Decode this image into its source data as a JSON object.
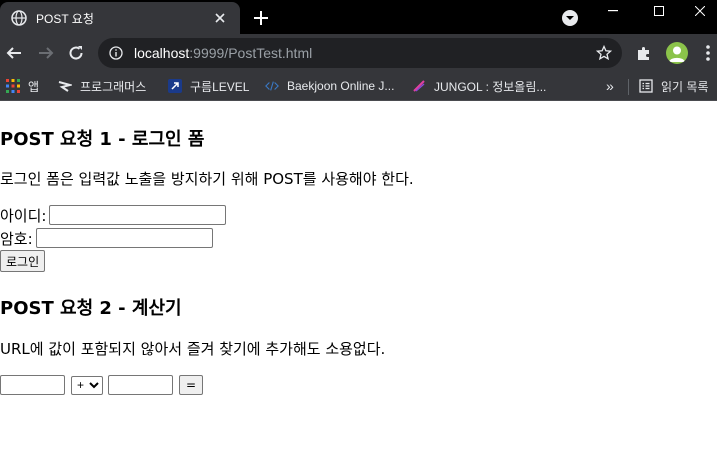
{
  "browser": {
    "tab_title": "POST 요청",
    "url_host": "localhost",
    "url_path": ":9999/PostTest.html",
    "bookmarks": [
      {
        "label": "앱",
        "icon": "apps-grid-icon"
      },
      {
        "label": "프로그래머스",
        "icon": "programmers-icon"
      },
      {
        "label": "구름LEVEL",
        "icon": "goorm-icon"
      },
      {
        "label": "Baekjoon Online J...",
        "icon": "baekjoon-icon"
      },
      {
        "label": "JUNGOL : 정보올림...",
        "icon": "jungol-icon"
      },
      {
        "label": "읽기 목록",
        "icon": "reading-list-icon"
      }
    ],
    "overflow_label": "»"
  },
  "page": {
    "section1": {
      "title": "POST 요청 1 - 로그인 폼",
      "description": "로그인 폼은 입력값 노출을 방지하기 위해 POST를 사용해야 한다.",
      "id_label": "아이디:",
      "id_value": "",
      "pw_label": "암호:",
      "pw_value": "",
      "login_button": "로그인"
    },
    "section2": {
      "title": "POST 요청 2 - 계산기",
      "description": "URL에 값이 포함되지 않아서 즐겨 찾기에 추가해도 소용없다.",
      "operand1": "",
      "operator": "+",
      "operand2": "",
      "equals_button": "="
    }
  }
}
